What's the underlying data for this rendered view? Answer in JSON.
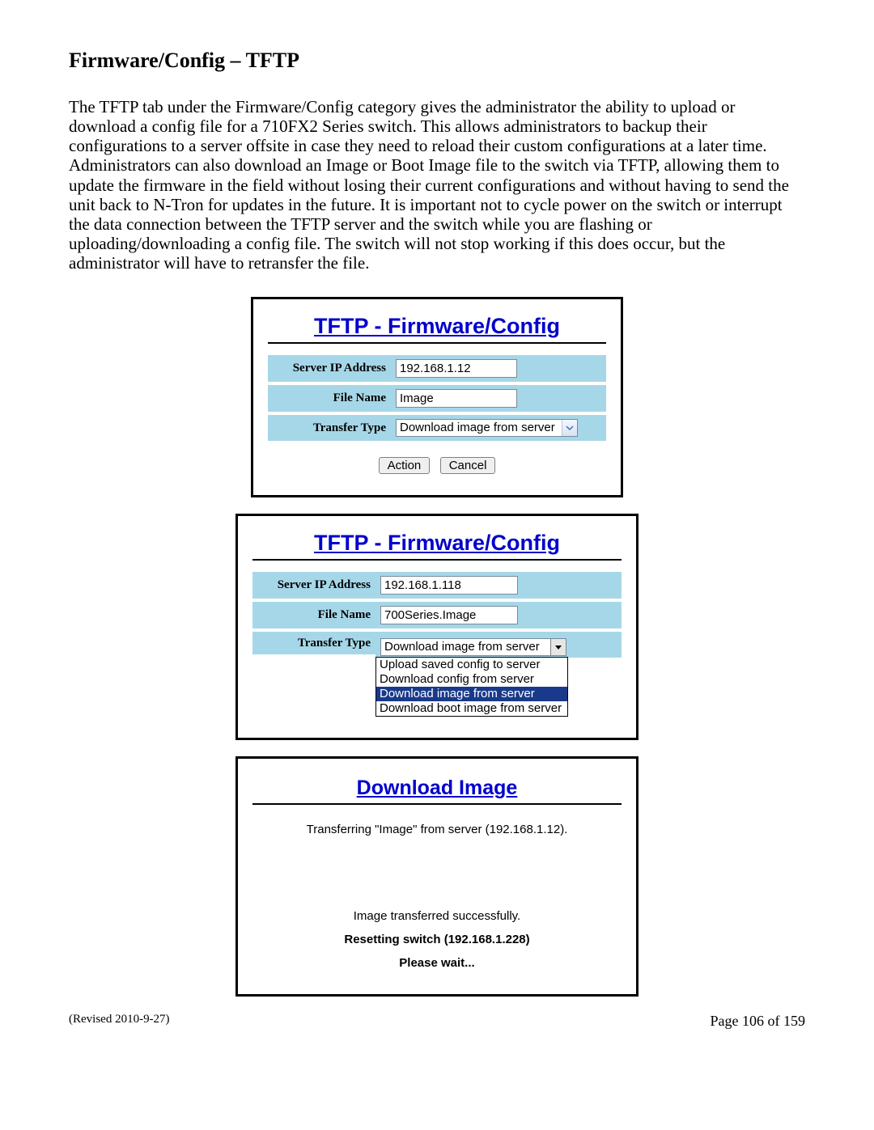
{
  "heading": "Firmware/Config – TFTP",
  "paragraph": "The TFTP tab under the Firmware/Config category gives the administrator the ability to upload or download a config file for a 710FX2 Series switch.  This allows administrators to backup their configurations to a server offsite in case they need to reload their custom configurations at a later time.  Administrators can also download an Image or Boot Image file to the switch via TFTP, allowing them to update the firmware in the field without losing their current configurations and without having to send the unit back to N-Tron for updates in the future.  It is important not to cycle power on the switch or interrupt the data connection between the TFTP server and the switch while you are flashing or uploading/downloading a config file.  The switch will not stop working if this does occur, but the administrator will have to retransfer the file.",
  "panel1": {
    "title": "TFTP - Firmware/Config",
    "labels": {
      "server_ip": "Server IP Address",
      "file_name": "File Name",
      "transfer_type": "Transfer Type"
    },
    "server_ip": "192.168.1.12",
    "file_name": "Image",
    "transfer_type": "Download image from server",
    "buttons": {
      "action": "Action",
      "cancel": "Cancel"
    }
  },
  "panel2": {
    "title": "TFTP - Firmware/Config",
    "labels": {
      "server_ip": "Server IP Address",
      "file_name": "File Name",
      "transfer_type": "Transfer Type"
    },
    "server_ip": "192.168.1.118",
    "file_name": "700Series.Image",
    "transfer_type": "Download image from server",
    "options": [
      "Upload saved config to server",
      "Download config from server",
      "Download image from server",
      "Download boot image from server"
    ],
    "selected_index": 2
  },
  "panel3": {
    "title": "Download Image",
    "line1": "Transferring \"Image\" from server (192.168.1.12).",
    "line2": "Image transferred successfully.",
    "line3": "Resetting switch (192.168.1.228)",
    "line4": "Please wait..."
  },
  "footer": {
    "left": "(Revised 2010-9-27)",
    "right": "Page 106 of 159"
  }
}
